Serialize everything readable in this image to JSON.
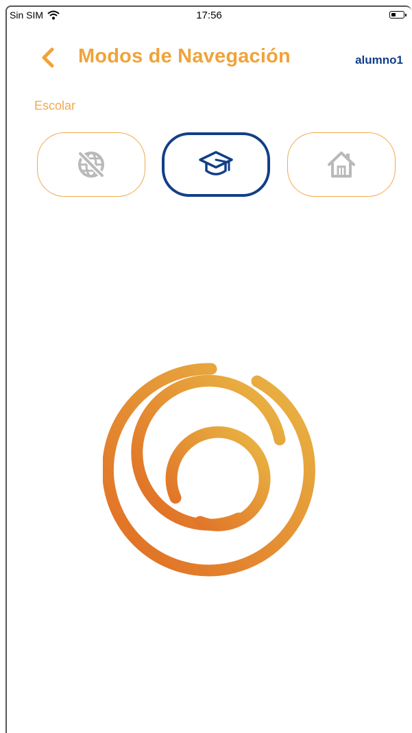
{
  "status_bar": {
    "carrier": "Sin SIM",
    "time": "17:56"
  },
  "header": {
    "title": "Modos de Navegación",
    "user": "alumno1"
  },
  "mode": {
    "current_label": "Escolar",
    "buttons": [
      {
        "name": "sin-internet",
        "icon": "no-internet-globe-icon",
        "selected": false
      },
      {
        "name": "escolar",
        "icon": "graduation-cap-icon",
        "selected": true
      },
      {
        "name": "casa",
        "icon": "home-icon",
        "selected": false
      }
    ]
  },
  "colors": {
    "accent_orange": "#f0a33a",
    "selected_blue": "#123f88",
    "inactive_gray": "#b9b9b9",
    "logo_gradient_start": "#e06a23",
    "logo_gradient_end": "#e9b845"
  }
}
